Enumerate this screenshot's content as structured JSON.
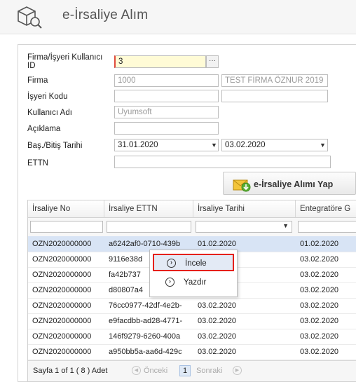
{
  "header": {
    "title": "e-İrsaliye Alım",
    "icon": "box-search-icon"
  },
  "form": {
    "firma_label": "Firma/İşyeri Kullanıcı ID",
    "firma_value": "3",
    "firma_lookup": "···",
    "firma_code_label": "Firma",
    "firma_code_value": "1000",
    "firma_name_value": "TEST FİRMA ÖZNUR 2019",
    "isyeri_label": "İşyeri Kodu",
    "isyeri_value": "",
    "kullanici_label": "Kullanıcı Adı",
    "kullanici_value": "Uyumsoft",
    "aciklama_label": "Açıklama",
    "aciklama_value": "",
    "tarih_label": "Baş./Bitiş Tarihi",
    "tarih_baslangic": "31.01.2020",
    "tarih_bitis": "03.02.2020",
    "ettn_label": "ETTN",
    "ettn_value": ""
  },
  "action_button": {
    "label": "e-İrsaliye Alımı Yap",
    "icon": "envelope-download-icon"
  },
  "grid": {
    "columns": [
      "İrsaliye No",
      "İrsaliye ETTN",
      "İrsaliye Tarihi",
      "Entegratöre G"
    ],
    "rows": [
      [
        "OZN2020000000",
        "a6242af0-0710-439b",
        "01.02.2020",
        "01.02.2020"
      ],
      [
        "OZN2020000000",
        "9116e38d",
        "",
        "03.02.2020"
      ],
      [
        "OZN2020000000",
        "fa42b737",
        "",
        "03.02.2020"
      ],
      [
        "OZN2020000000",
        "d80807a4",
        "",
        "03.02.2020"
      ],
      [
        "OZN2020000000",
        "76cc0977-42df-4e2b-",
        "03.02.2020",
        "03.02.2020"
      ],
      [
        "OZN2020000000",
        "e9facdbb-ad28-4771-",
        "03.02.2020",
        "03.02.2020"
      ],
      [
        "OZN2020000000",
        "146f9279-6260-400a",
        "03.02.2020",
        "03.02.2020"
      ],
      [
        "OZN2020000000",
        "a950bb5a-aa6d-429c",
        "03.02.2020",
        "03.02.2020"
      ]
    ],
    "selected_row": 0
  },
  "pager": {
    "summary": "Sayfa 1 of 1 ( 8 ) Adet",
    "prev": "Önceki",
    "page": "1",
    "next": "Sonraki"
  },
  "context_menu": {
    "items": [
      {
        "label": "İncele",
        "icon": "chevron-circle-icon",
        "highlighted": true
      },
      {
        "label": "Yazdır",
        "icon": "chevron-circle-icon",
        "highlighted": false
      }
    ]
  },
  "colors": {
    "highlight_border": "#e5201b",
    "selected_row": "#d8e4f5",
    "required_bg": "#fffbd6"
  }
}
